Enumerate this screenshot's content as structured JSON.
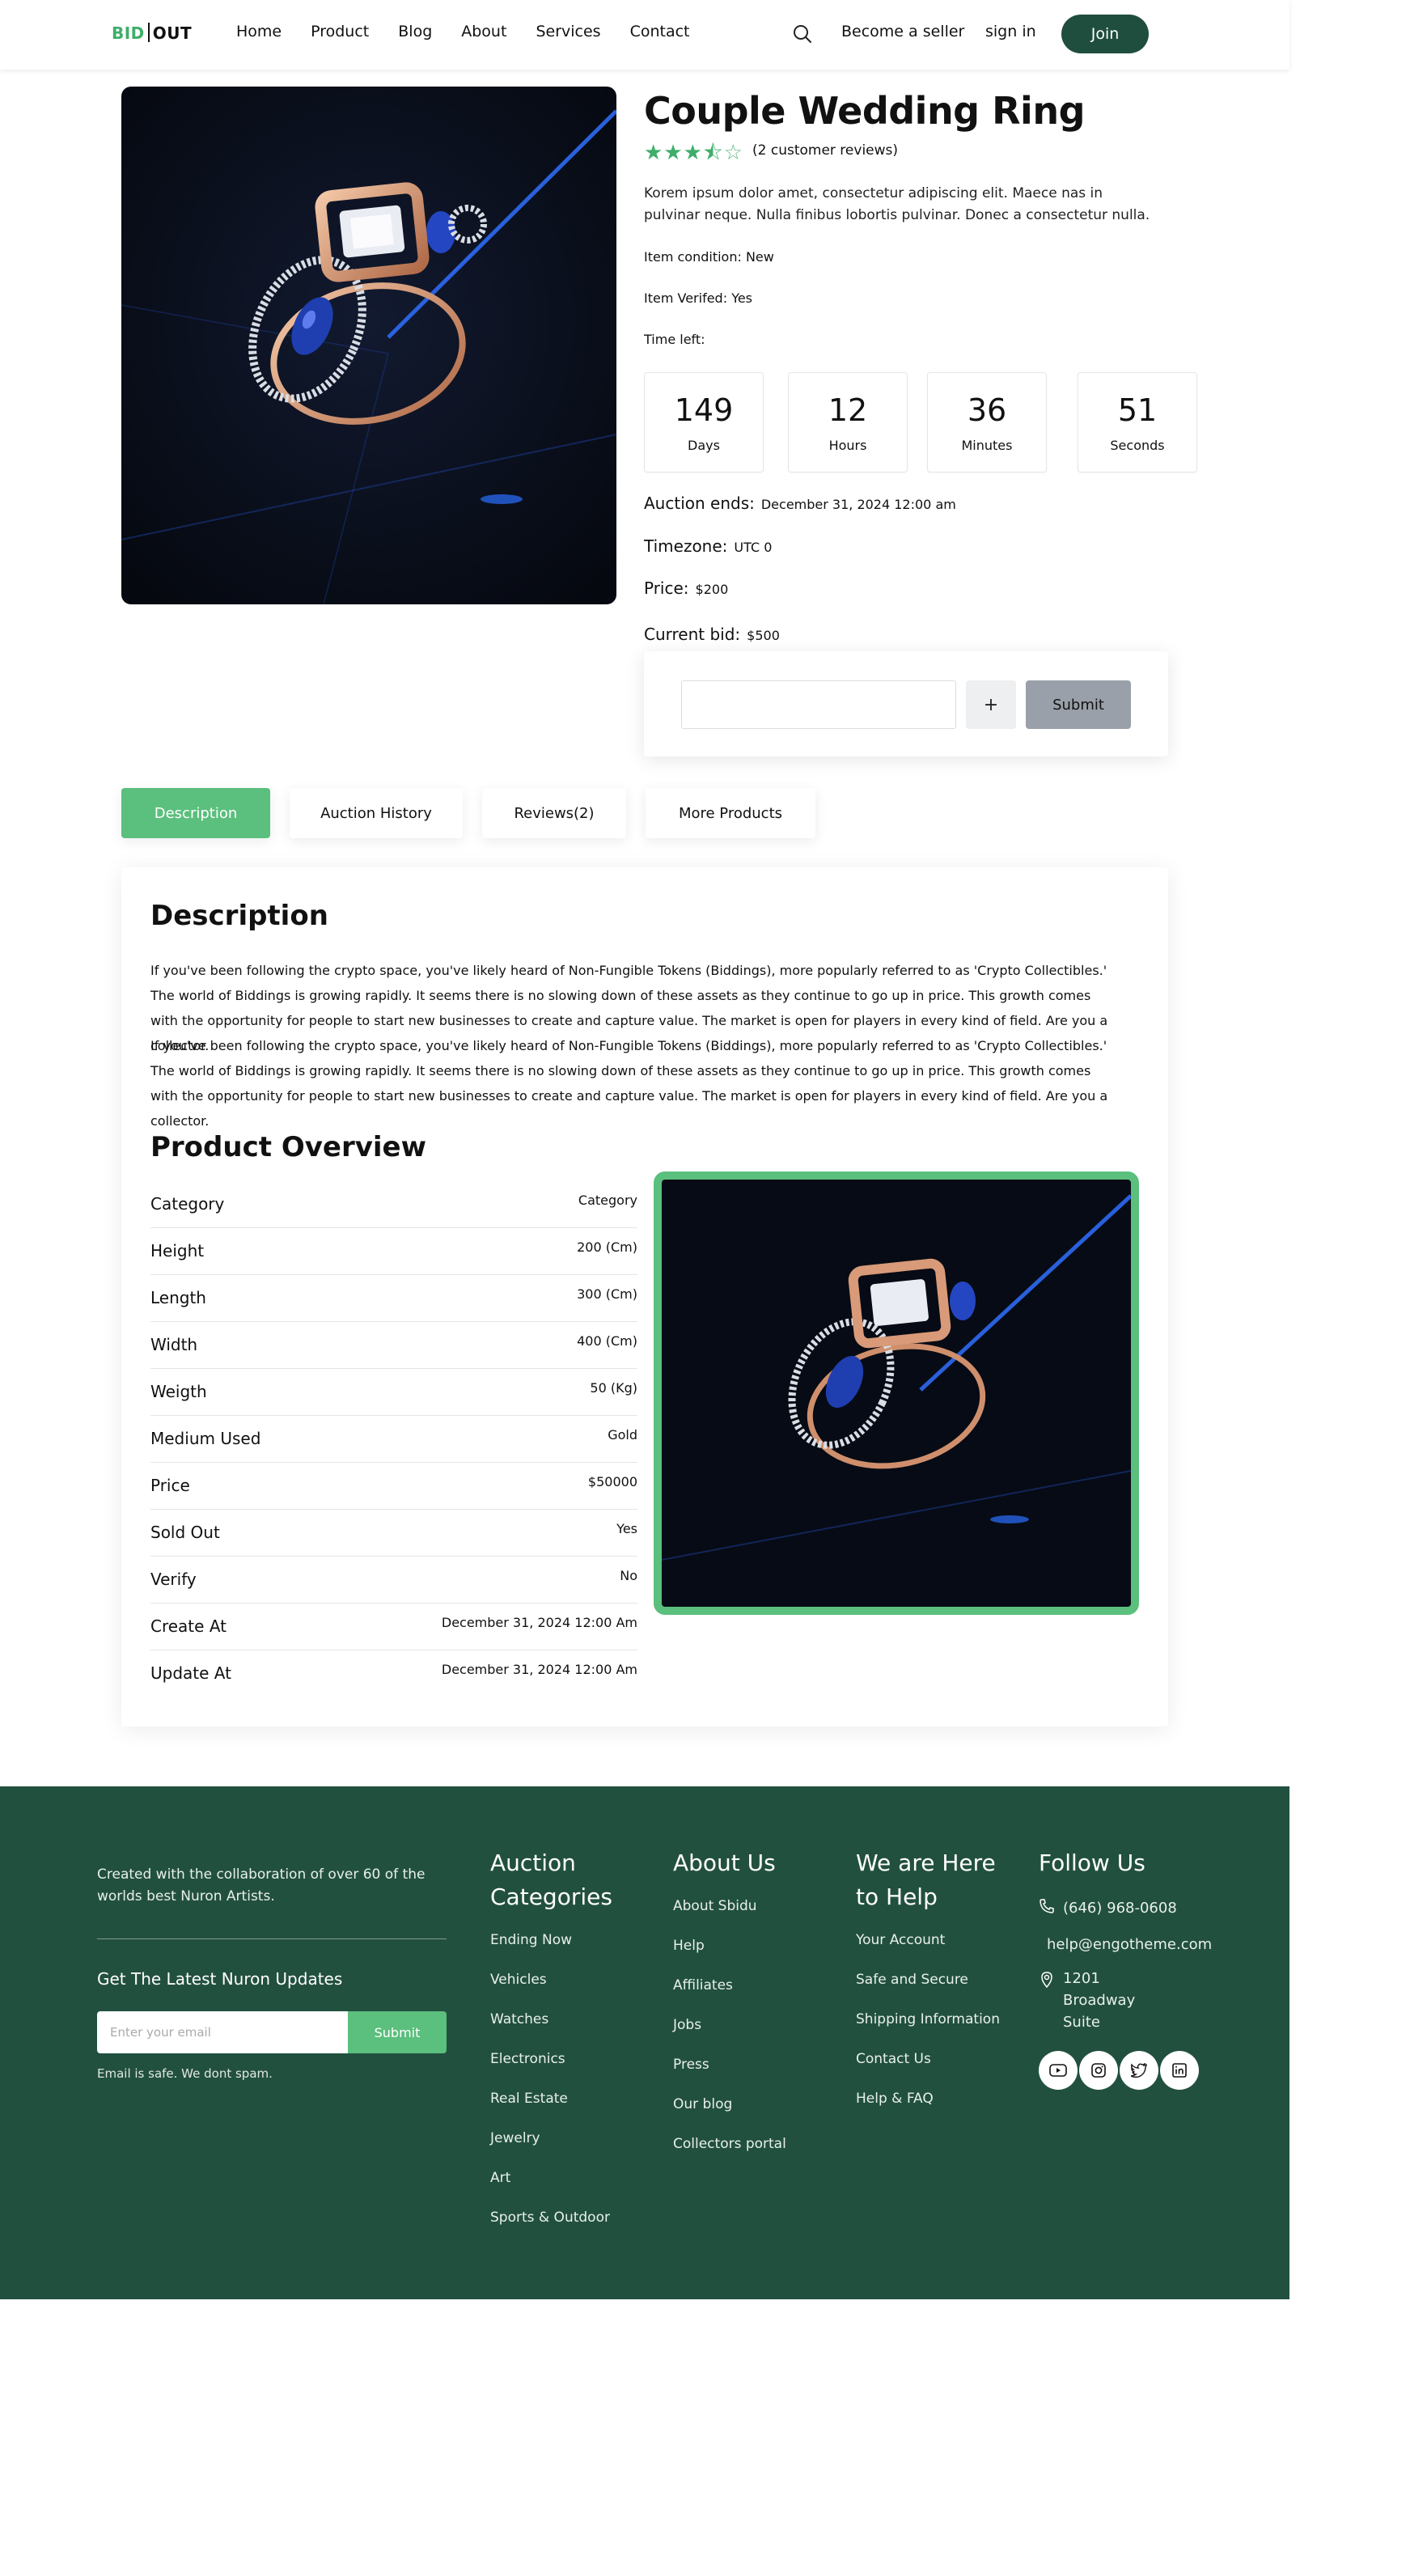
{
  "header": {
    "logo_bid": "BID",
    "logo_out": "OUT",
    "nav": [
      "Home",
      "Product",
      "Blog",
      "About",
      "Services",
      "Contact"
    ],
    "become_seller": "Become a seller",
    "sign_in": "sign in",
    "join": "Join"
  },
  "product": {
    "title": "Couple Wedding Ring",
    "rating": 3.5,
    "rating_max": 5,
    "reviews_count": "(2 customer reviews)",
    "short_description": "Korem ipsum dolor amet, consectetur adipiscing elit. Maece nas in pulvinar neque. Nulla finibus lobortis pulvinar. Donec a consectetur nulla.",
    "condition": "Item condition: New",
    "verified": "Item Verifed: Yes",
    "time_left_label": "Time left:",
    "timer": [
      {
        "value": "149",
        "label": "Days"
      },
      {
        "value": "12",
        "label": "Hours"
      },
      {
        "value": "36",
        "label": "Minutes"
      },
      {
        "value": "51",
        "label": "Seconds"
      }
    ],
    "auction_ends_label": "Auction ends:",
    "auction_ends_value": "December 31, 2024 12:00 am",
    "timezone_label": "Timezone:",
    "timezone_value": "UTC 0",
    "price_label": "Price:",
    "price_value": "$200",
    "current_bid_label": "Current bid:",
    "current_bid_value": "$500",
    "bid_plus": "+",
    "bid_submit": "Submit"
  },
  "tabs": [
    "Description",
    "Auction History",
    "Reviews(2)",
    "More Products"
  ],
  "description": {
    "heading": "Description",
    "para1": "If you've been following the crypto space, you've likely heard of Non-Fungible Tokens (Biddings), more popularly referred to as 'Crypto Collectibles.' The world of Biddings is growing rapidly. It seems there is no slowing down of these assets as they continue to go up in price. This growth comes with the opportunity for people to start new businesses to create and capture value. The market is open for players in every kind of field. Are you a collector.",
    "para2": "If you've been following the crypto space, you've likely heard of Non-Fungible Tokens (Biddings), more popularly referred to as 'Crypto Collectibles.' The world of Biddings is growing rapidly. It seems there is no slowing down of these assets as they continue to go up in price. This growth comes with the opportunity for people to start new businesses to create and capture value. The market is open for players in every kind of field. Are you a collector.",
    "overview_heading": "Product Overview",
    "specs": [
      {
        "key": "Category",
        "value": "Category"
      },
      {
        "key": "Height",
        "value": "200 (Cm)"
      },
      {
        "key": "Length",
        "value": "300 (Cm)"
      },
      {
        "key": "Width",
        "value": "400 (Cm)"
      },
      {
        "key": "Weigth",
        "value": "50 (Kg)"
      },
      {
        "key": "Medium Used",
        "value": "Gold"
      },
      {
        "key": "Price",
        "value": "$50000"
      },
      {
        "key": "Sold Out",
        "value": "Yes"
      },
      {
        "key": "Verify",
        "value": "No"
      },
      {
        "key": "Create At",
        "value": "December 31, 2024 12:00 Am"
      },
      {
        "key": "Update At",
        "value": "December 31, 2024 12:00 Am"
      }
    ]
  },
  "footer": {
    "about": "Created with the collaboration of over 60 of the worlds best Nuron Artists.",
    "updates_heading": "Get The Latest Nuron Updates",
    "email_placeholder": "Enter your email",
    "submit": "Submit",
    "spam_note": "Email is safe. We dont spam.",
    "auction_categories": {
      "heading": "Auction Categories",
      "items": [
        "Ending Now",
        "Vehicles",
        "Watches",
        "Electronics",
        "Real Estate",
        "Jewelry",
        "Art",
        "Sports & Outdoor"
      ]
    },
    "about_us": {
      "heading": "About Us",
      "items": [
        "About Sbidu",
        "Help",
        "Affiliates",
        "Jobs",
        "Press",
        "Our blog",
        "Collectors portal"
      ]
    },
    "help": {
      "heading": "We are Here to Help",
      "items": [
        "Your Account",
        "Safe and Secure",
        "Shipping Information",
        "Contact Us",
        "Help & FAQ"
      ]
    },
    "follow": {
      "heading": "Follow Us",
      "phone": "(646) 968-0608",
      "email": "help@engotheme.com",
      "address": "1201 Broadway Suite",
      "socials": [
        "youtube-icon",
        "instagram-icon",
        "twitter-icon",
        "linkedin-icon"
      ]
    }
  },
  "colors": {
    "brand_green": "#5bbf7d",
    "dark_green": "#1f4d3e",
    "footer_bg": "#22503f",
    "submit_gray": "#9aa0a9"
  }
}
